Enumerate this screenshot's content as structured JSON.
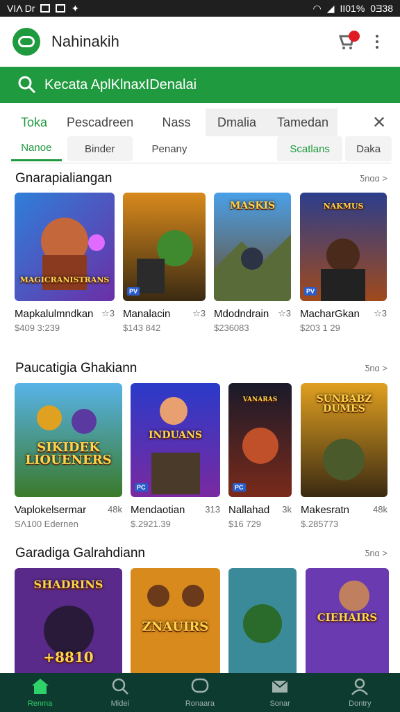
{
  "status_bar": {
    "left_text": "VΙΛ Dr",
    "right_text": "ΙΙ01%",
    "clock": "0Ǝ38"
  },
  "app": {
    "title": "Nahinakih"
  },
  "search": {
    "placeholder": "Kecata AplKlnaxIDenalai"
  },
  "tabs": [
    "Toka",
    "Pescadreen",
    "Nass",
    "Dmalia",
    "Tamedan"
  ],
  "subtabs": [
    "Nanoe",
    "Binder",
    "Penany",
    "Scatlans",
    "Daka"
  ],
  "colors": {
    "accent": "#1f9a3e",
    "nav_bg": "#0d3b2f",
    "nav_active": "#2fd16a"
  },
  "sections": [
    {
      "title": "Gnarapialiangan",
      "more": "Ƽnɑɑ >",
      "items": [
        {
          "name": "Mapkalulmndkan",
          "rating": "☆3",
          "price": "$409 3:239",
          "art_title": "MAGICRANISTRANS"
        },
        {
          "name": "Manalacin",
          "rating": "☆3",
          "price": "$143 842",
          "art_title": ""
        },
        {
          "name": "Mdodndrain",
          "rating": "☆3",
          "price": "$236083",
          "art_title": "MASKIS"
        },
        {
          "name": "MacharGkan",
          "rating": "☆3",
          "price": "$203 1 29",
          "art_title": "NAKMUS"
        }
      ]
    },
    {
      "title": "Paucatigia Ghakiann",
      "more": "Ƽnɑ >",
      "items": [
        {
          "name": "Vaplokelsermar",
          "rating": "48k",
          "price": "SΛ100 Edernen",
          "art_title": "SIKIDEK LIOUENERS"
        },
        {
          "name": "Mendaotian",
          "rating": "313",
          "price": "$.2921.39",
          "art_title": "INDUANS"
        },
        {
          "name": "Nallahad",
          "rating": "3k",
          "price": "$16 729",
          "art_title": "VANARAS"
        },
        {
          "name": "Makesratn",
          "rating": "48k",
          "price": "$.285773",
          "art_title": "SUNBABZ DUMES"
        }
      ]
    },
    {
      "title": "Garadiga Galrahdiann",
      "more": "Ƽnɑ >",
      "items": [
        {
          "name": "",
          "rating": "",
          "price": "",
          "art_title": "SHADRINS",
          "art_price": "+8810"
        },
        {
          "name": "",
          "rating": "",
          "price": "",
          "art_title": "ZNAUIRS"
        },
        {
          "name": "",
          "rating": "",
          "price": "",
          "art_title": ""
        },
        {
          "name": "",
          "rating": "",
          "price": "",
          "art_title": "CIEHAIRS"
        }
      ]
    }
  ],
  "bottom_nav": [
    {
      "label": "Renma",
      "icon": "home-icon"
    },
    {
      "label": "Midei",
      "icon": "search-icon"
    },
    {
      "label": "Ronaara",
      "icon": "chat-icon"
    },
    {
      "label": "Sonar",
      "icon": "inbox-icon"
    },
    {
      "label": "Dontry",
      "icon": "profile-icon"
    }
  ]
}
